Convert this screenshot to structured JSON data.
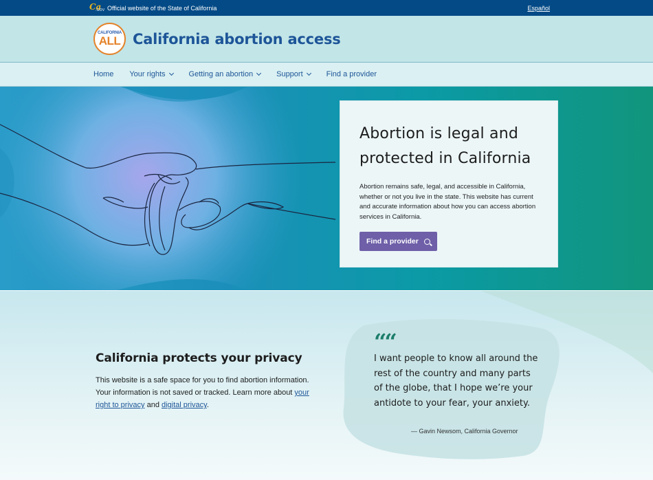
{
  "gov_bar": {
    "official_text": "Official website of the State of California",
    "language_link": "Español"
  },
  "brand": {
    "badge_top": "CALIFORNIA",
    "badge_bottom": "ALL",
    "title": "California abortion access"
  },
  "nav": {
    "items": [
      {
        "label": "Home",
        "has_dropdown": false
      },
      {
        "label": "Your rights",
        "has_dropdown": true
      },
      {
        "label": "Getting an abortion",
        "has_dropdown": true
      },
      {
        "label": "Support",
        "has_dropdown": true
      },
      {
        "label": "Find a provider",
        "has_dropdown": false
      }
    ]
  },
  "hero": {
    "heading": "Abortion is legal and protected in California",
    "body": "Abortion remains safe, legal, and accessible in California, whether or not you live in the state. This website has current and accurate information about how you can access abortion services in California.",
    "button_label": "Find a provider",
    "button_icon": "search-icon"
  },
  "privacy": {
    "heading": "California protects your privacy",
    "body_prefix": "This website is a safe space for you to find abortion information. Your information is not saved or tracked. Learn more about ",
    "link1": "your right to privacy",
    "connector": " and ",
    "link2": "digital privacy",
    "suffix": "."
  },
  "quote": {
    "mark": "““",
    "text": "I want people to know all around the rest of the country and many parts of the globe, that I hope we’re your antidote to your fear, your anxiety.",
    "attribution": "— Gavin Newsom, California Governor"
  },
  "colors": {
    "gov_bar": "#034a86",
    "brand_blue": "#1d5598",
    "button_purple": "#6e5fa8",
    "quote_green": "#1b7d6a",
    "badge_orange": "#e4832a"
  }
}
